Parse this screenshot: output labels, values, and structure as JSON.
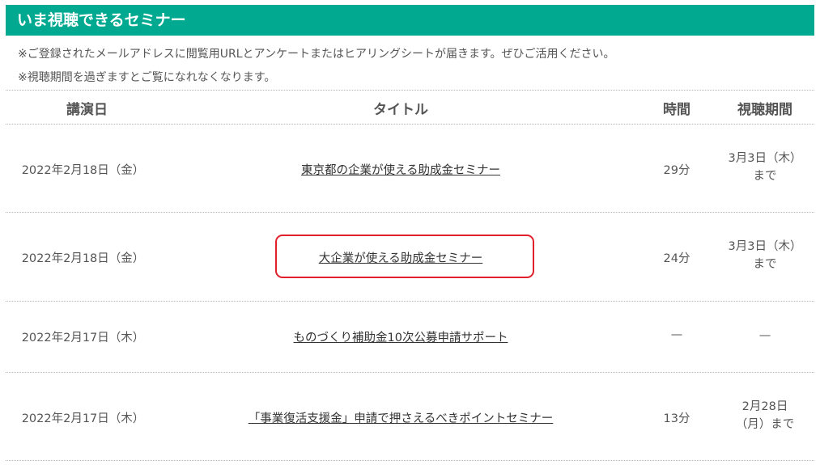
{
  "header": {
    "title": "いま視聴できるセミナー"
  },
  "notes": [
    "※ご登録されたメールアドレスに閲覧用URLとアンケートまたはヒアリングシートが届きます。ぜひご活用ください。",
    "※視聴期間を過ぎますとご覧になれなくなります。"
  ],
  "table": {
    "headers": {
      "date": "講演日",
      "title": "タイトル",
      "time": "時間",
      "period": "視聴期間"
    },
    "rows": [
      {
        "date": "2022年2月18日（金）",
        "title": "東京都の企業が使える助成金セミナー",
        "time": "29分",
        "period_line1": "3月3日（木）",
        "period_line2": "まで"
      },
      {
        "date": "2022年2月18日（金）",
        "title": "大企業が使える助成金セミナー",
        "time": "24分",
        "period_line1": "3月3日（木）",
        "period_line2": "まで"
      },
      {
        "date": "2022年2月17日（木）",
        "title": "ものづくり補助金10次公募申請サポート",
        "time": "—",
        "period_line1": "—",
        "period_line2": ""
      },
      {
        "date": "2022年2月17日（木）",
        "title": "「事業復活支援金」申請で押さえるべきポイントセミナー",
        "time": "13分",
        "period_line1": "2月28日",
        "period_line2": "（月）まで"
      }
    ]
  },
  "colors": {
    "header_bg": "#00a98f",
    "highlight_border": "#e2202a"
  }
}
